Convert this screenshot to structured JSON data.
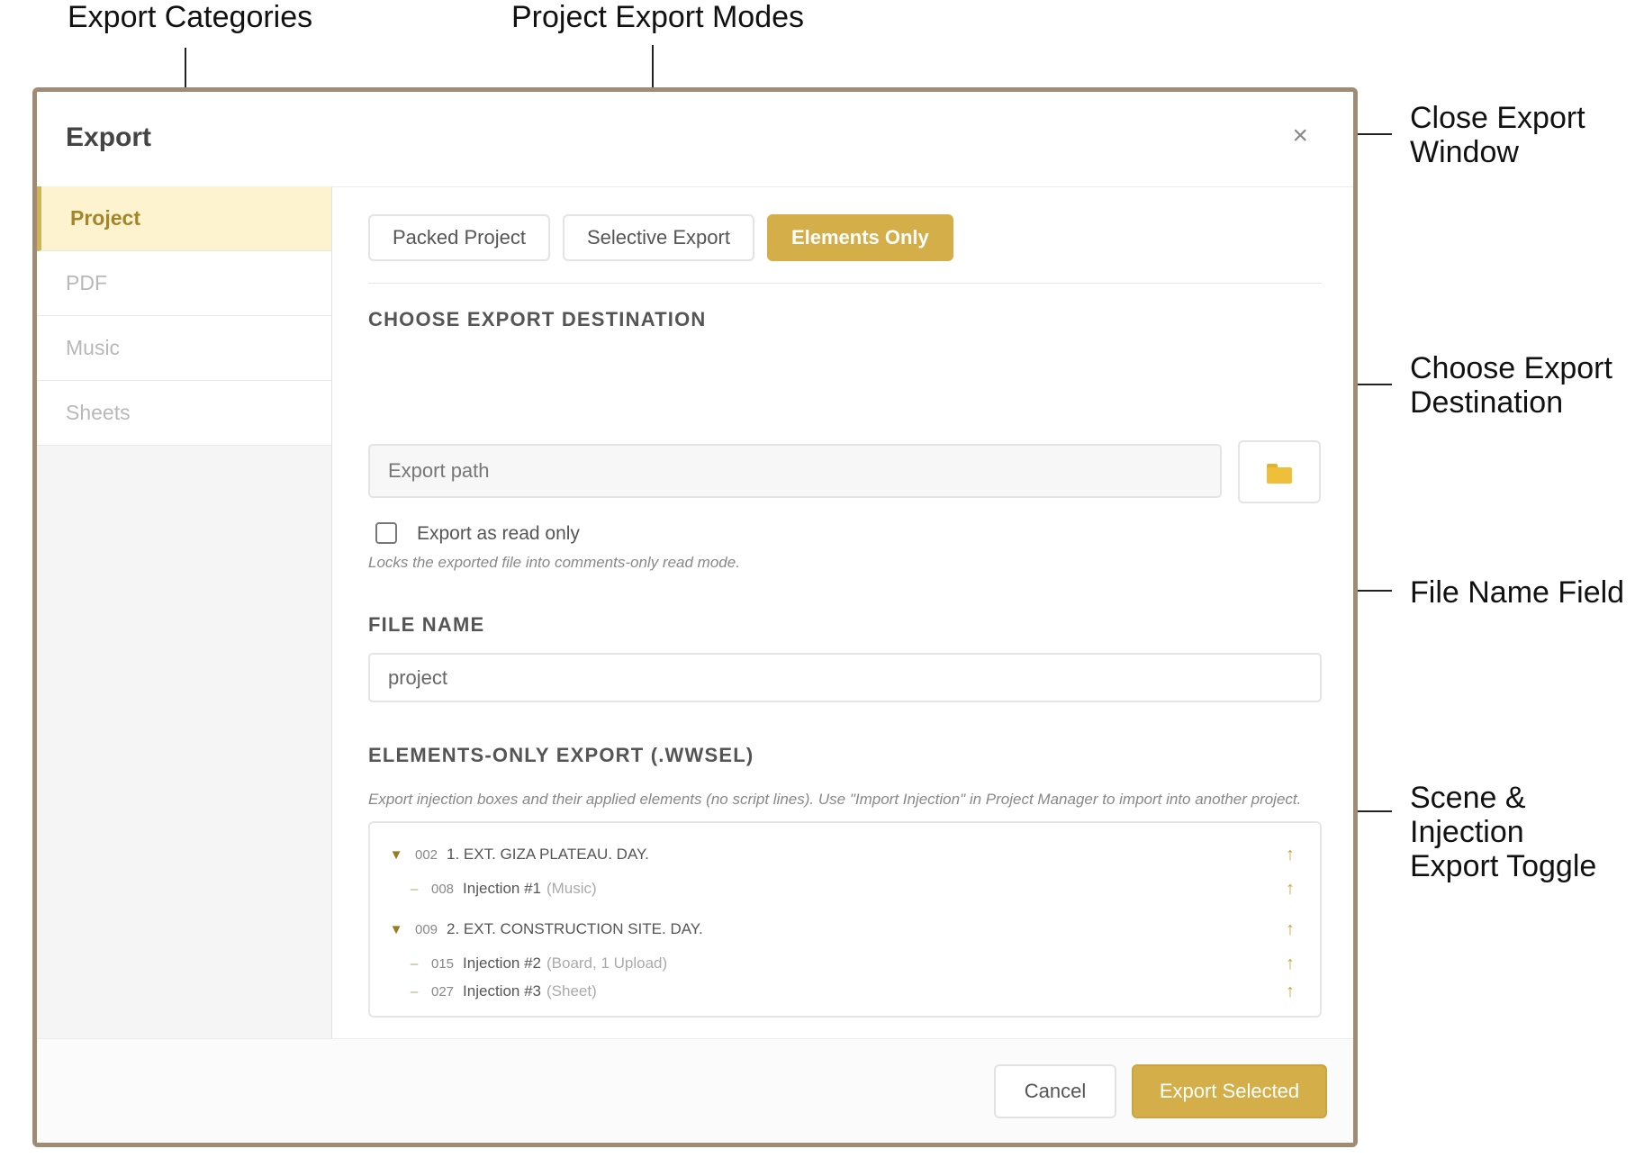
{
  "annotations": {
    "export_categories": "Export Categories",
    "project_export_modes": "Project Export Modes",
    "close_export_window": "Close Export\nWindow",
    "choose_export_destination": "Choose Export\nDestination",
    "file_name_field": "File Name Field",
    "scene_injection_toggle": "Scene & Injection\nExport Toggle"
  },
  "dialog": {
    "title": "Export",
    "close_icon": "×"
  },
  "sidebar": {
    "items": [
      {
        "label": "Project",
        "active": true
      },
      {
        "label": "PDF",
        "active": false
      },
      {
        "label": "Music",
        "active": false
      },
      {
        "label": "Sheets",
        "active": false
      }
    ]
  },
  "tabs": [
    {
      "label": "Packed Project",
      "active": false
    },
    {
      "label": "Selective Export",
      "active": false
    },
    {
      "label": "Elements Only",
      "active": true
    }
  ],
  "destination": {
    "section_title": "CHOOSE EXPORT DESTINATION",
    "path_placeholder": "Export path",
    "readonly_label": "Export as read only",
    "readonly_checked": false,
    "readonly_hint": "Locks the exported file into comments-only read mode."
  },
  "file_name": {
    "section_title": "FILE NAME",
    "value": "project"
  },
  "elements_export": {
    "section_title": "ELEMENTS-ONLY EXPORT (.WWSEL)",
    "description": "Export injection boxes and their applied elements (no script lines). Use \"Import Injection\" in Project Manager to import into another project.",
    "tree": [
      {
        "kind": "scene",
        "expander": "▼",
        "num": "002",
        "title": "1. EXT. GIZA PLATEAU. DAY.",
        "toggle": "↑"
      },
      {
        "kind": "injection",
        "expander": "–",
        "num": "008",
        "name": "Injection #1",
        "meta": "(Music)",
        "toggle": "↑"
      },
      {
        "kind": "scene",
        "expander": "▼",
        "num": "009",
        "title": "2. EXT. CONSTRUCTION SITE. DAY.",
        "toggle": "↑"
      },
      {
        "kind": "injection",
        "expander": "–",
        "num": "015",
        "name": "Injection #2",
        "meta": "(Board, 1 Upload)",
        "toggle": "↑"
      },
      {
        "kind": "injection",
        "expander": "–",
        "num": "027",
        "name": "Injection #3",
        "meta": "(Sheet)",
        "toggle": "↑"
      }
    ]
  },
  "footer": {
    "cancel_label": "Cancel",
    "export_label": "Export Selected"
  },
  "colors": {
    "accent": "#d3ae49",
    "active_sidebar_bg": "#fdf3cf",
    "active_sidebar_text": "#a5852a",
    "dialog_border": "#a08c74"
  }
}
